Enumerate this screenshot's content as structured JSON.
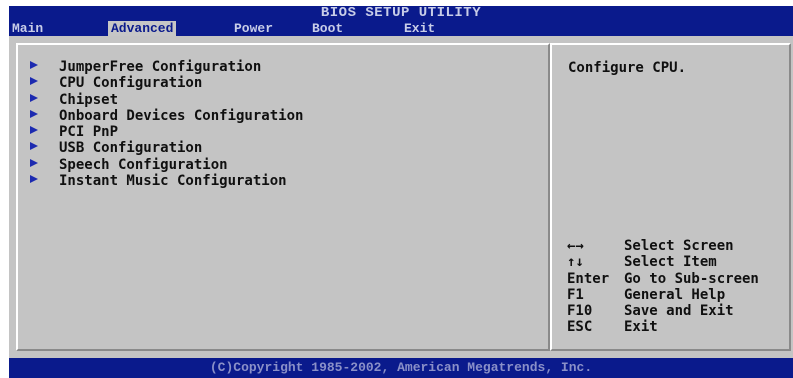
{
  "header": {
    "title": "BIOS SETUP UTILITY",
    "tabs": [
      {
        "label": "Main",
        "active": false
      },
      {
        "label": "Advanced",
        "active": true
      },
      {
        "label": "Power",
        "active": false
      },
      {
        "label": "Boot",
        "active": false
      },
      {
        "label": "Exit",
        "active": false
      }
    ]
  },
  "menu": {
    "items": [
      {
        "label": "JumperFree Configuration"
      },
      {
        "label": "CPU Configuration"
      },
      {
        "label": "Chipset"
      },
      {
        "label": "Onboard Devices Configuration"
      },
      {
        "label": "PCI PnP"
      },
      {
        "label": "USB Configuration"
      },
      {
        "label": "Speech Configuration"
      },
      {
        "label": "Instant Music Configuration"
      }
    ]
  },
  "help": {
    "text": "Configure CPU.",
    "keys": [
      {
        "key": "←→",
        "action": "Select Screen"
      },
      {
        "key": "↑↓",
        "action": "Select Item"
      },
      {
        "key": "Enter",
        "action": "Go to Sub-screen"
      },
      {
        "key": "F1",
        "action": "General Help"
      },
      {
        "key": "F10",
        "action": "Save and Exit"
      },
      {
        "key": "ESC",
        "action": "Exit"
      }
    ]
  },
  "footer": {
    "text": "(C)Copyright 1985-2002, American Megatrends, Inc."
  },
  "colors": {
    "header_bg": "#0a1a8c",
    "panel_bg": "#c4c4c4",
    "arrow": "#1c2ab0"
  }
}
